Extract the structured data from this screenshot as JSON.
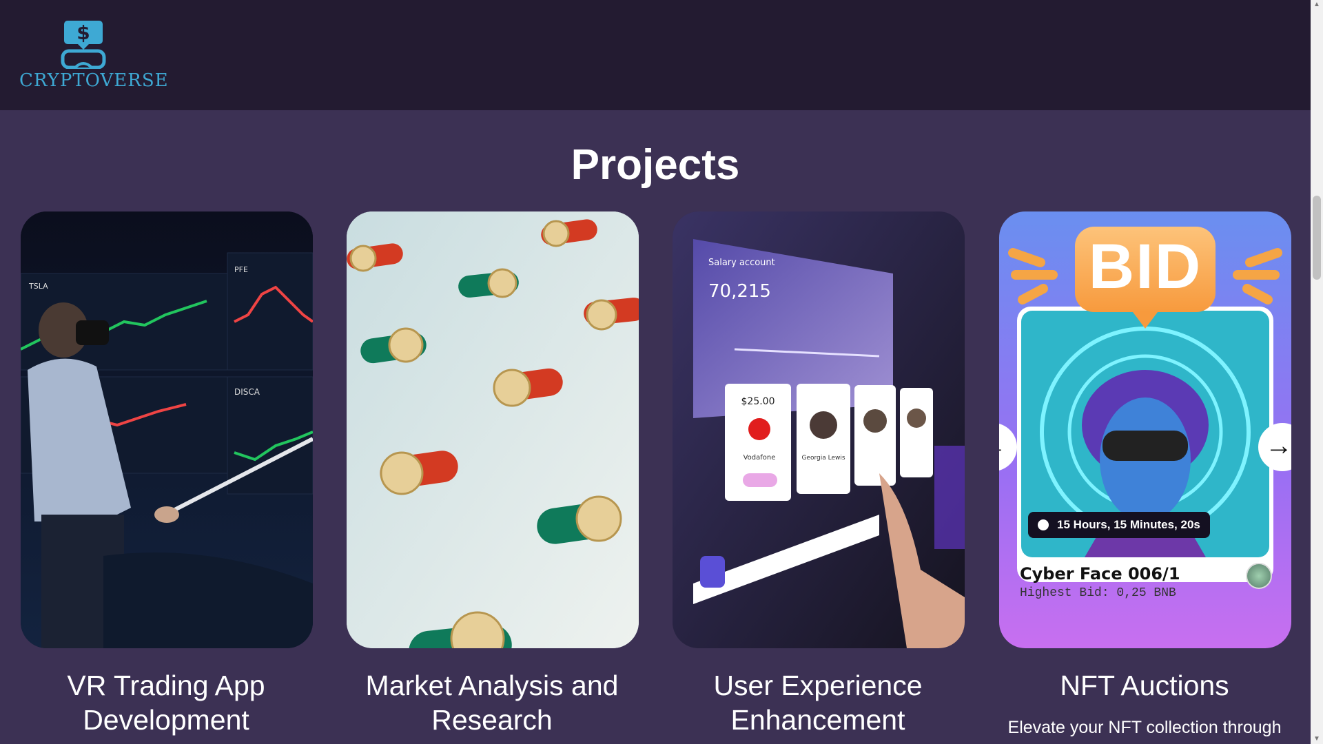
{
  "brand": {
    "name": "CRYPTOVERSE",
    "logo_icon": "dollar-vr-headset-icon"
  },
  "section": {
    "title": "Projects"
  },
  "projects": [
    {
      "title": "VR Trading App Development",
      "image_icon": "vr-trading-image",
      "chart_labels": [
        "TSLA",
        "PFE",
        "DISCA"
      ]
    },
    {
      "title": "Market Analysis and Research",
      "image_icon": "coin-toggles-image"
    },
    {
      "title": "User Experience Enhancement",
      "image_icon": "banking-ui-image",
      "ui": {
        "account": "Salary account",
        "balance": "70,215",
        "pay_amount": "$25.00",
        "payee": "Vodafone",
        "contact": "Georgia Lewis"
      }
    },
    {
      "title": "NFT Auctions",
      "image_icon": "nft-auction-image",
      "description": "Elevate your NFT collection through",
      "nft": {
        "badge": "BID",
        "timer": "15 Hours, 15 Minutes, 20s",
        "name": "Cyber Face 006/1",
        "highest_bid": "Highest Bid: 0,25 BNB"
      }
    }
  ],
  "carousel": {
    "prev": "←",
    "next": "→"
  },
  "colors": {
    "header_bg": "#231b31",
    "page_bg": "#3c3154",
    "accent": "#3ea9d4"
  }
}
